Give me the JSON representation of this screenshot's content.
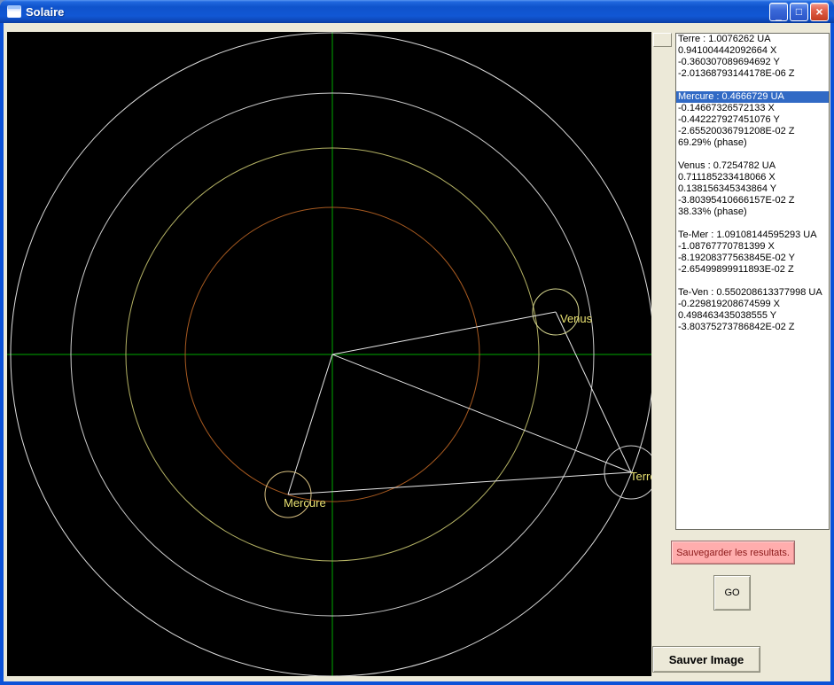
{
  "window": {
    "title": "Solaire",
    "controls": {
      "minimize_glyph": "_",
      "maximize_glyph": "□",
      "close_glyph": "×"
    }
  },
  "canvas": {
    "labels": {
      "venus": "Venus",
      "mercure": "Mercure",
      "terre": "Terre"
    },
    "colors": {
      "background": "#000000",
      "axes_green": "#00a800",
      "earth_orbit": "#dedede",
      "outer_ring": "#cccccc",
      "venus_orbit_yellow": "#b4b264",
      "mercury_orbit_orange": "#a85a20",
      "connection_lines": "#e8e8e8",
      "label_yellow": "#e8e070"
    }
  },
  "results_list": {
    "selected_index": 5,
    "selection_color": "#316AC5",
    "items": [
      "Terre : 1.0076262 UA",
      "0.941004442092664 X",
      "-0.360307089694692 Y",
      "-2.01368793144178E-06 Z",
      "",
      "Mercure : 0.4666729 UA",
      "-0.14667326572133 X",
      "-0.442227927451076 Y",
      "-2.65520036791208E-02 Z",
      "69.29% (phase)",
      "",
      "Venus : 0.7254782 UA",
      "0.711185233418066 X",
      "0.138156345343864 Y",
      "-3.80395410666157E-02 Z",
      "38.33% (phase)",
      "",
      "Te-Mer : 1.09108144595293 UA",
      "-1.08767770781399 X",
      "-8.19208377563845E-02 Y",
      "-2.65499899911893E-02 Z",
      "",
      "Te-Ven : 0.550208613377998 UA",
      "-0.229819208674599 X",
      "0.498463435038555 Y",
      "-3.80375273786842E-02 Z"
    ]
  },
  "buttons": {
    "save_results_label": "Sauvegarder les resultats.",
    "go_label": "GO",
    "save_image_label": "Sauver Image"
  }
}
